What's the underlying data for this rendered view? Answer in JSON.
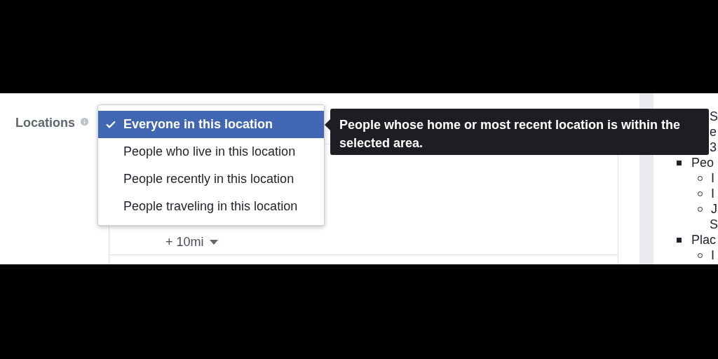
{
  "field": {
    "label": "Locations"
  },
  "dropdown": {
    "options": [
      {
        "label": "Everyone in this location",
        "selected": true
      },
      {
        "label": "People who live in this location",
        "selected": false
      },
      {
        "label": "People recently in this location",
        "selected": false
      },
      {
        "label": "People traveling in this location",
        "selected": false
      }
    ]
  },
  "tooltip": {
    "text": "People whose home or most recent location is within the selected area."
  },
  "radius": {
    "value": "+ 10mi"
  },
  "sidebar": {
    "lines": [
      {
        "kind": "text",
        "text": "S"
      },
      {
        "kind": "text",
        "text": "e"
      },
      {
        "kind": "text",
        "text": "3"
      },
      {
        "kind": "bullet",
        "text": "Peo"
      },
      {
        "kind": "sub_bullet",
        "text": "I"
      },
      {
        "kind": "sub_bullet",
        "text": "I"
      },
      {
        "kind": "sub_bullet",
        "text": "J"
      },
      {
        "kind": "text",
        "text": "S"
      },
      {
        "kind": "bullet",
        "text": "Plac"
      },
      {
        "kind": "sub_bullet",
        "text": "I"
      }
    ]
  }
}
